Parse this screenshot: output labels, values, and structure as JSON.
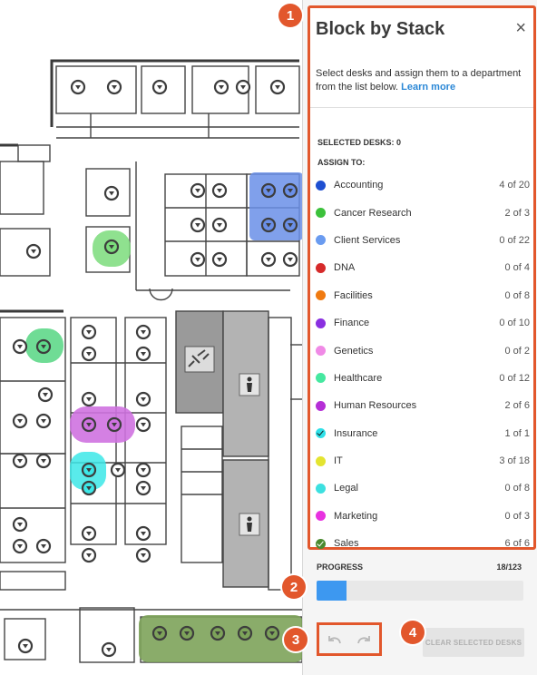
{
  "panel": {
    "title": "Block by Stack",
    "close": "×",
    "description": "Select desks and assign them to a department from the list below.",
    "learn_more": "Learn more",
    "selected_desks_label": "SELECTED DESKS: 0",
    "assign_to_label": "ASSIGN TO:"
  },
  "departments": [
    {
      "name": "Accounting",
      "count": "4 of 20",
      "color": "#1f4fd1",
      "icon": "dot"
    },
    {
      "name": "Cancer Research",
      "count": "2 of 3",
      "color": "#3cc13b",
      "icon": "dot"
    },
    {
      "name": "Client Services",
      "count": "0 of 22",
      "color": "#6a9bf0",
      "icon": "dot"
    },
    {
      "name": "DNA",
      "count": "0 of 4",
      "color": "#d62a2a",
      "icon": "dot"
    },
    {
      "name": "Facilities",
      "count": "0 of 8",
      "color": "#f07a10",
      "icon": "dot"
    },
    {
      "name": "Finance",
      "count": "0 of 10",
      "color": "#8a30e0",
      "icon": "dot"
    },
    {
      "name": "Genetics",
      "count": "0 of 2",
      "color": "#f08ae6",
      "icon": "dot"
    },
    {
      "name": "Healthcare",
      "count": "0 of 12",
      "color": "#46e8a0",
      "icon": "dot"
    },
    {
      "name": "Human Resources",
      "count": "2 of 6",
      "color": "#b52fd6",
      "icon": "dot"
    },
    {
      "name": "Insurance",
      "count": "1 of 1",
      "color": "#2fe0e8",
      "icon": "check-dark"
    },
    {
      "name": "IT",
      "count": "3 of 18",
      "color": "#e4e430",
      "icon": "dot"
    },
    {
      "name": "Legal",
      "count": "0 of 8",
      "color": "#3de0e0",
      "icon": "dot"
    },
    {
      "name": "Marketing",
      "count": "0 of 3",
      "color": "#e832e0",
      "icon": "dot"
    },
    {
      "name": "Sales",
      "count": "6 of 6",
      "color": "#4a8a2e",
      "icon": "check"
    }
  ],
  "progress": {
    "label": "PROGRESS",
    "count": "18/123",
    "value": 18,
    "total": 123
  },
  "toolbar": {
    "clear_label": "CLEAR SELECTED DESKS"
  },
  "callouts": [
    "1",
    "2",
    "3",
    "4"
  ],
  "colors": {
    "accent": "#e2572c",
    "progress": "#3d98f0",
    "link": "#2a87d6"
  }
}
